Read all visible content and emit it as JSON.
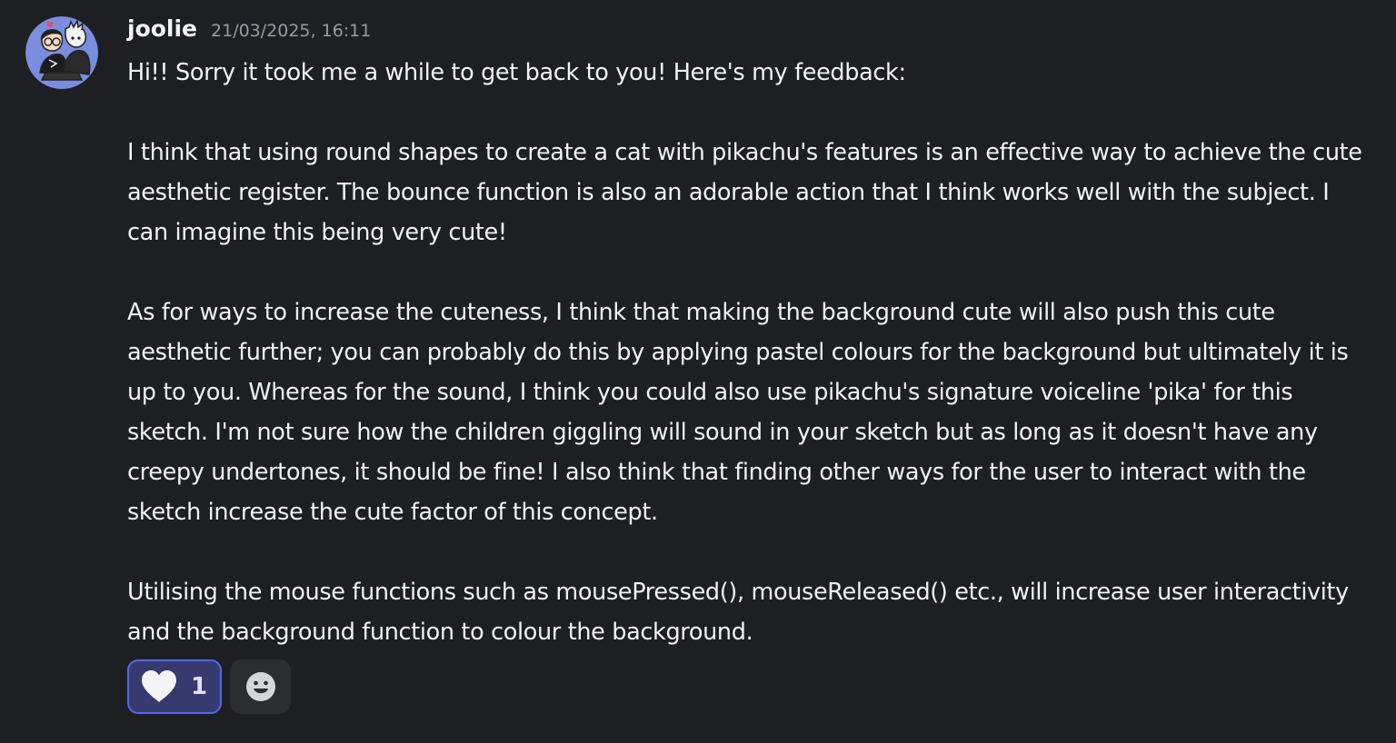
{
  "message": {
    "username": "joolie",
    "timestamp": "21/03/2025, 16:11",
    "paragraphs": [
      "Hi!! Sorry it took me a while to get back to you! Here's my feedback:",
      "I think that using round shapes to create a cat with pikachu's features is an effective way to achieve the cute aesthetic register. The bounce function is also an adorable action that I think works well with the subject. I can imagine this being very cute!",
      "As for ways to increase the cuteness, I think that making the background cute will also push this cute aesthetic further; you can probably do this by applying pastel colours for the background but ultimately it is up to you. Whereas for the sound, I think you could also use pikachu's signature voiceline 'pika' for this sketch. I'm not sure how the children giggling will sound in your sketch but as long as it doesn't have any creepy undertones, it should be fine! I also think that finding other ways for the user to interact with the sketch increase the cute factor of this concept.",
      "Utilising the mouse functions such as mousePressed(), mouseReleased() etc., will increase user interactivity and the background function to colour the background."
    ]
  },
  "reactions": [
    {
      "icon": "heart-icon",
      "count": "1",
      "active": true
    }
  ],
  "add_reaction": {
    "icon": "smiley-face-icon"
  },
  "colors": {
    "background": "#1e1f22",
    "text": "#f2f3f5",
    "timestamp": "#949ba4",
    "reaction_active_bg": "#373a6f",
    "reaction_active_border": "#5865f2",
    "add_reaction_bg": "#2b2d31",
    "avatar_bg": "#7a8dde"
  }
}
